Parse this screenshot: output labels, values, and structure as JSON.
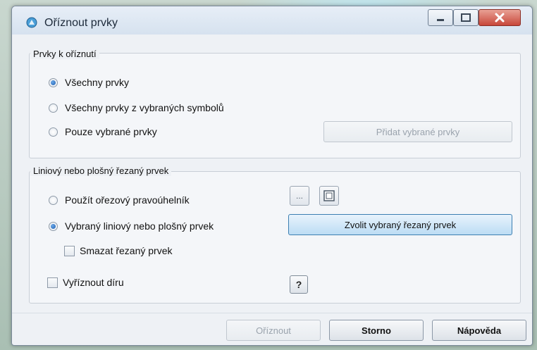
{
  "window": {
    "title": "Oříznout prvky",
    "controls": {
      "minimize": "minimize",
      "maximize": "maximize",
      "close": "close"
    }
  },
  "group_features": {
    "legend": "Prvky k oříznutí",
    "options": [
      {
        "label": "Všechny prvky",
        "selected": true
      },
      {
        "label": "Všechny prvky z vybraných symbolů",
        "selected": false
      },
      {
        "label": "Pouze vybrané prvky",
        "selected": false
      }
    ],
    "add_selected_button": "Přidat vybrané prvky"
  },
  "group_cutter": {
    "legend": "Liniový nebo plošný řezaný prvek",
    "options": [
      {
        "label": "Použít ořezový pravoúhelník",
        "selected": false
      },
      {
        "label": "Vybraný liniový nebo plošný prvek",
        "selected": true
      }
    ],
    "ellipsis_button": "...",
    "choose_button": "Zvolit vybraný řezaný prvek",
    "delete_cutter_label": "Smazat řezaný prvek",
    "delete_cutter_checked": false,
    "cut_hole_label": "Vyříznout díru",
    "cut_hole_checked": false,
    "help_button": "?"
  },
  "footer": {
    "ok": "Oříznout",
    "cancel": "Storno",
    "help": "Nápověda"
  }
}
